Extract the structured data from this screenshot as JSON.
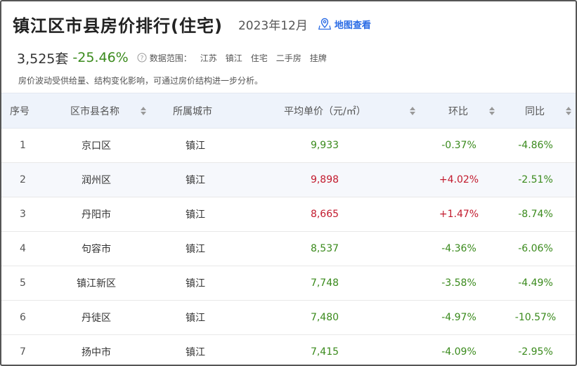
{
  "header": {
    "title": "镇江区市县房价排行(住宅)",
    "date": "2023年12月",
    "map_link": "地图查看"
  },
  "summary": {
    "count": "3,525套",
    "yoy": "-25.46%",
    "scope_label": "数据范围：",
    "scope_tags": [
      "江苏",
      "镇江",
      "住宅",
      "二手房",
      "挂牌"
    ],
    "note": "房价波动受供给量、结构变化影响，可通过房价结构进一步分析。"
  },
  "table": {
    "headers": {
      "index": "序号",
      "name": "区市县名称",
      "city": "所属城市",
      "price": "平均单价（元/㎡）",
      "mom": "环比",
      "yoy": "同比"
    },
    "rows": [
      {
        "index": "1",
        "name": "京口区",
        "city": "镇江",
        "price": "9,933",
        "price_color": "#3a8a1c",
        "mom": "-0.37%",
        "mom_color": "#3a8a1c",
        "yoy": "-4.86%",
        "yoy_color": "#3a8a1c"
      },
      {
        "index": "2",
        "name": "润州区",
        "city": "镇江",
        "price": "9,898",
        "price_color": "#c21a2d",
        "mom": "+4.02%",
        "mom_color": "#c21a2d",
        "yoy": "-2.51%",
        "yoy_color": "#3a8a1c"
      },
      {
        "index": "3",
        "name": "丹阳市",
        "city": "镇江",
        "price": "8,665",
        "price_color": "#c21a2d",
        "mom": "+1.47%",
        "mom_color": "#c21a2d",
        "yoy": "-8.74%",
        "yoy_color": "#3a8a1c"
      },
      {
        "index": "4",
        "name": "句容市",
        "city": "镇江",
        "price": "8,537",
        "price_color": "#3a8a1c",
        "mom": "-4.36%",
        "mom_color": "#3a8a1c",
        "yoy": "-6.06%",
        "yoy_color": "#3a8a1c"
      },
      {
        "index": "5",
        "name": "镇江新区",
        "city": "镇江",
        "price": "7,748",
        "price_color": "#3a8a1c",
        "mom": "-3.58%",
        "mom_color": "#3a8a1c",
        "yoy": "-4.49%",
        "yoy_color": "#3a8a1c"
      },
      {
        "index": "6",
        "name": "丹徒区",
        "city": "镇江",
        "price": "7,480",
        "price_color": "#3a8a1c",
        "mom": "-4.97%",
        "mom_color": "#3a8a1c",
        "yoy": "-10.57%",
        "yoy_color": "#3a8a1c"
      },
      {
        "index": "7",
        "name": "扬中市",
        "city": "镇江",
        "price": "7,415",
        "price_color": "#3a8a1c",
        "mom": "-4.09%",
        "mom_color": "#3a8a1c",
        "yoy": "-2.95%",
        "yoy_color": "#3a8a1c"
      }
    ]
  }
}
